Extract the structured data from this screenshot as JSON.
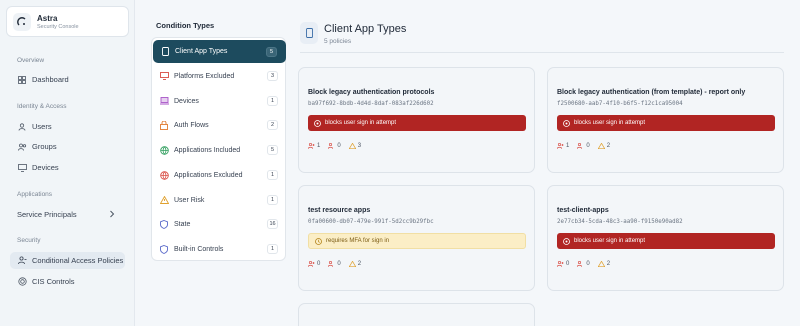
{
  "brand": {
    "title": "Astra",
    "subtitle": "Security Console",
    "icon": "shield-logo-icon"
  },
  "sidebar": {
    "sections": [
      {
        "label": "Overview",
        "items": [
          {
            "label": "Dashboard",
            "icon": "grid-icon"
          }
        ]
      },
      {
        "label": "Identity & Access",
        "items": [
          {
            "label": "Users",
            "icon": "user-icon"
          },
          {
            "label": "Groups",
            "icon": "users-icon"
          },
          {
            "label": "Devices",
            "icon": "monitor-icon"
          }
        ]
      },
      {
        "label": "Applications",
        "items": [
          {
            "label": "Service Principals",
            "icon": "chevron-right-icon"
          }
        ]
      },
      {
        "label": "Security",
        "items": [
          {
            "label": "Conditional Access Policies",
            "icon": "policy-icon",
            "active": true
          },
          {
            "label": "CIS Controls",
            "icon": "target-icon"
          }
        ]
      }
    ]
  },
  "conditions": {
    "title": "Condition Types",
    "items": [
      {
        "label": "Client App Types",
        "count": "5",
        "icon": "tablet-icon",
        "color": "#ffffff",
        "active": true
      },
      {
        "label": "Platforms Excluded",
        "count": "3",
        "icon": "monitor-icon",
        "color": "#d94c43"
      },
      {
        "label": "Devices",
        "count": "1",
        "icon": "laptop-icon",
        "color": "#a855c7"
      },
      {
        "label": "Auth Flows",
        "count": "2",
        "icon": "lock-icon",
        "color": "#e07a2e"
      },
      {
        "label": "Applications Included",
        "count": "5",
        "icon": "globe-icon",
        "color": "#2f9e5d"
      },
      {
        "label": "Applications Excluded",
        "count": "1",
        "icon": "globe-icon",
        "color": "#d94c43"
      },
      {
        "label": "User Risk",
        "count": "1",
        "icon": "warning-icon",
        "color": "#e0a12e"
      },
      {
        "label": "State",
        "count": "16",
        "icon": "shield-icon",
        "color": "#5868c9"
      },
      {
        "label": "Built-in Controls",
        "count": "1",
        "icon": "shield-icon",
        "color": "#5868c9"
      }
    ]
  },
  "main": {
    "title": "Client App Types",
    "subtitle": "5 policies",
    "cards": [
      {
        "name": "Block legacy authentication protocols",
        "id": "ba97f692-8bdb-4d4d-8daf-083af226d602",
        "bar": "blocks user sign in attempt",
        "bar_type": "block",
        "stats": [
          "1",
          "0",
          "3"
        ]
      },
      {
        "name": "Block legacy authentication (from template) - report only",
        "id": "f2500680-aab7-4f10-b6f5-f12c1ca95004",
        "bar": "blocks user sign in attempt",
        "bar_type": "block",
        "stats": [
          "1",
          "0",
          "2"
        ]
      },
      {
        "name": "test resource apps",
        "id": "0fa00600-db07-479e-991f-5d2cc9b29fbc",
        "bar": "requires MFA for sign in",
        "bar_type": "mfa",
        "stats": [
          "0",
          "0",
          "2"
        ]
      },
      {
        "name": "test-client-apps",
        "id": "2e77cb34-5cda-48c3-aa90-f9150e90ad82",
        "bar": "blocks user sign in attempt",
        "bar_type": "block",
        "stats": [
          "0",
          "0",
          "2"
        ]
      }
    ]
  },
  "colors": {
    "accent": "#1d4b5e",
    "block": "#b12523",
    "mfa_bg": "#fbeec6"
  }
}
